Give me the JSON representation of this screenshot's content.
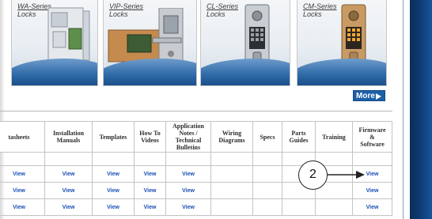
{
  "products": [
    {
      "title": "WA-Series",
      "subtitle": "Locks"
    },
    {
      "title": "VIP-Series",
      "subtitle": "Locks"
    },
    {
      "title": "CL-Series",
      "subtitle": "Locks"
    },
    {
      "title": "CM-Series",
      "subtitle": "Locks"
    }
  ],
  "more_button": {
    "label": "More",
    "icon": "triangle-right-icon"
  },
  "table": {
    "headers": [
      [
        "tasheets"
      ],
      [
        "Installation",
        "Manuals"
      ],
      [
        "Templates"
      ],
      [
        "How To",
        "Videos"
      ],
      [
        "Application",
        "Notes /",
        "Technical",
        "Bulletins"
      ],
      [
        "Wiring",
        "Diagrams"
      ],
      [
        "Specs"
      ],
      [
        "Parts",
        "Guides"
      ],
      [
        "Training"
      ],
      [
        "Firmware",
        "&",
        "Software"
      ]
    ],
    "rows": [
      [
        "View",
        "View",
        "View",
        "View",
        "View",
        "",
        "",
        "",
        "",
        "View"
      ],
      [
        "View",
        "View",
        "View",
        "View",
        "View",
        "",
        "",
        "",
        "",
        "View"
      ],
      [
        "View",
        "View",
        "View",
        "View",
        "View",
        "",
        "",
        "",
        "",
        "View"
      ]
    ]
  },
  "callout": {
    "label": "2"
  },
  "colors": {
    "link": "#1a4fb5",
    "button": "#1d5fa8",
    "band": "#0e3a72"
  }
}
